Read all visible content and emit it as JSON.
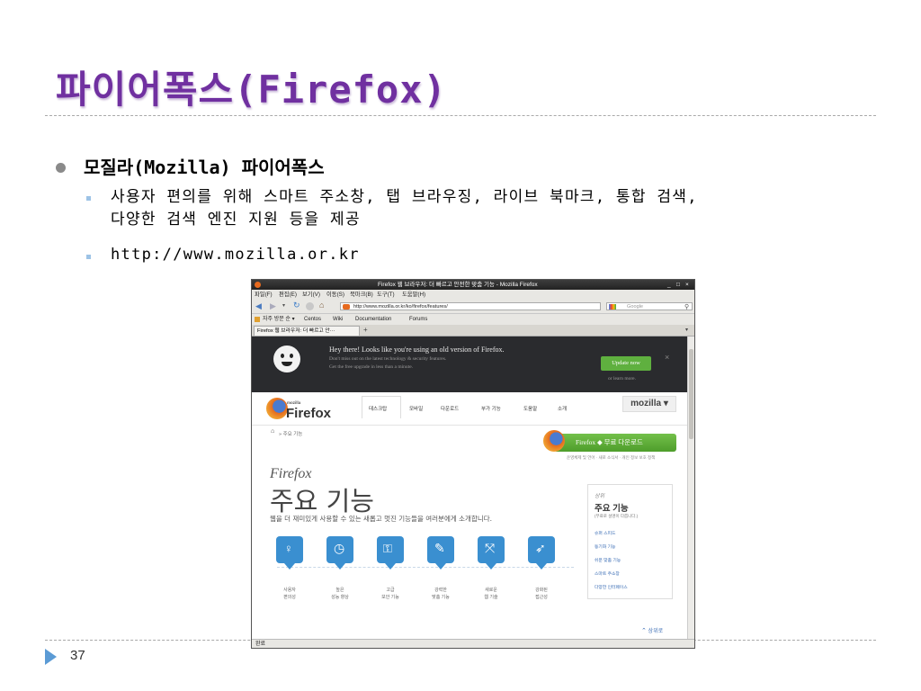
{
  "slide": {
    "title": "파이어폭스(Firefox)",
    "bullet": "모질라(Mozilla) 파이어폭스",
    "sub_bullets": [
      [
        "사용자 편의를 위해 스마트 주소창, 탭 브라우징, 라이브 북마크, 통합 검색,",
        "다양한 검색 엔진 지원 등을 제공"
      ],
      [
        "http://www.mozilla.or.kr"
      ]
    ],
    "page_number": "37"
  },
  "browser": {
    "window_title": "Firefox 웹 브라우저: 더 빠르고 안전한 맞춤 기능 - Mozilla Firefox",
    "window_controls": [
      "_",
      "□",
      "×"
    ],
    "menu": [
      "파일(F)",
      "편집(E)",
      "보기(V)",
      "이동(S)",
      "북마크(B)",
      "도구(T)",
      "도움말(H)"
    ],
    "url": "http://www.mozilla.or.kr/ko/firefox/features/",
    "search_placeholder": "Google",
    "bookmarks": [
      "자주 방문 순 ▾",
      "Centos",
      "Wiki",
      "Documentation",
      "Forums"
    ],
    "tab_label": "Firefox 웹 브라우저: 더 빠르고 안···",
    "new_tab": "+",
    "status": "완료"
  },
  "page": {
    "notice": {
      "title": "Hey there! Looks like you're using an old version of Firefox.",
      "line1": "Don't miss out on the latest technology & security features.",
      "line2": "Get the free upgrade in less than a minute.",
      "button": "Update now",
      "learn": "or learn more.",
      "close": "×"
    },
    "logo_small": "mozilla",
    "logo_word": "Firefox",
    "nav": [
      "데스크탑",
      "모바일",
      "다운로드",
      "부가 기능",
      "도움말",
      "소개"
    ],
    "mozilla_tab": "mozilla ▾",
    "breadcrumb": "» 주요 기능",
    "download_button": "Firefox ◆ 무료 다운로드",
    "download_sub": "운영체제 및 언어 · 새로 소식서 · 개인 정보 보호 정책",
    "hero_small": "Firefox",
    "hero_big": "주요 기능",
    "hero_desc": "웹을 더 재미있게 사용할 수 있는 새롭고 멋진 기능들을 여러분에게 소개합니다.",
    "sidebox": {
      "kicker": "상위",
      "title": "주요 기능",
      "note": "(무료로 설명이 다릅니다.)",
      "links": [
        "슈퍼 스피드",
        "동기화 기능",
        "쉬운 맞춤 기능",
        "스마트 주소창",
        "다양한 인터페이스"
      ]
    },
    "features": [
      "사용자\n편의성",
      "높은\n성능 향상",
      "고급\n보안 기능",
      "강력한\n맞춤 기능",
      "새로운\n웹 기술",
      "강화된\n접근성"
    ],
    "scroll_top": "상위로"
  },
  "colors": {
    "title": "#7030a0",
    "accent": "#5b9bd5",
    "green": "#5fb03f",
    "feature": "#3a8fd0"
  }
}
